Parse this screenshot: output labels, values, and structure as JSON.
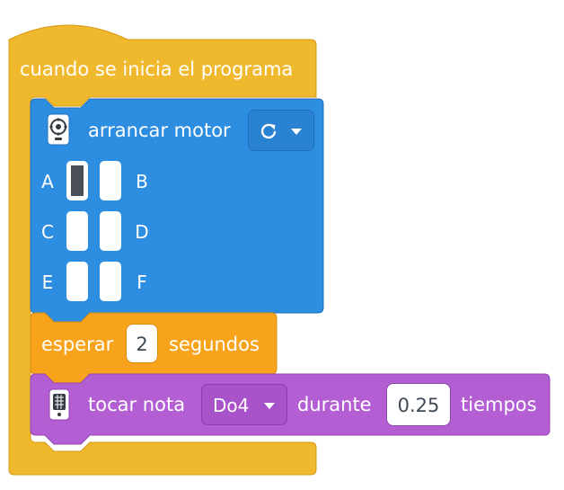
{
  "hat_block": {
    "label": "cuando se inicia el programa",
    "color": "#f0b82c"
  },
  "motor_block": {
    "icon": "motor-icon",
    "label": "arrancar motor",
    "direction_icon": "rotate-clockwise-icon",
    "color": "#2d8de0",
    "ports": [
      {
        "letter": "A",
        "selected": true
      },
      {
        "letter": "B",
        "selected": false
      },
      {
        "letter": "C",
        "selected": false
      },
      {
        "letter": "D",
        "selected": false
      },
      {
        "letter": "E",
        "selected": false
      },
      {
        "letter": "F",
        "selected": false
      }
    ]
  },
  "wait_block": {
    "label_before": "esperar",
    "value": "2",
    "label_after": "segundos",
    "color": "#f8a31c"
  },
  "note_block": {
    "icon": "speaker-icon",
    "label_before": "tocar nota",
    "note_value": "Do4",
    "label_middle": "durante",
    "duration_value": "0.25",
    "label_after": "tiempos",
    "color": "#b45ed4"
  }
}
